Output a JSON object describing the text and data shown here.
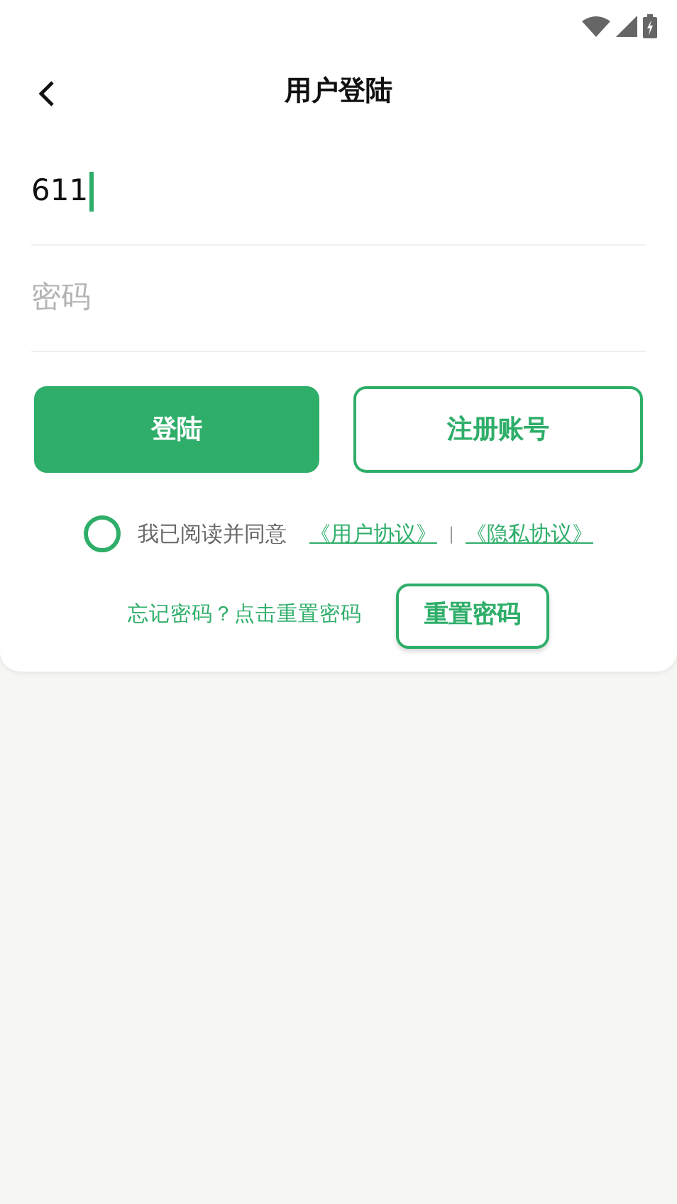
{
  "header": {
    "title": "用户登陆"
  },
  "username": {
    "value": "611",
    "focused": true
  },
  "password": {
    "placeholder": "密码"
  },
  "buttons": [
    {
      "label": "登陆",
      "kind": "primary"
    },
    {
      "label": "注册账号",
      "kind": "outline"
    }
  ],
  "agreement": {
    "checked": false,
    "text": "我已阅读并同意",
    "links": [
      "《用户协议》",
      "《隐私协议》"
    ],
    "separator": "|"
  },
  "reset": {
    "hint": "忘记密码？点击重置密码",
    "button": "重置密码"
  }
}
